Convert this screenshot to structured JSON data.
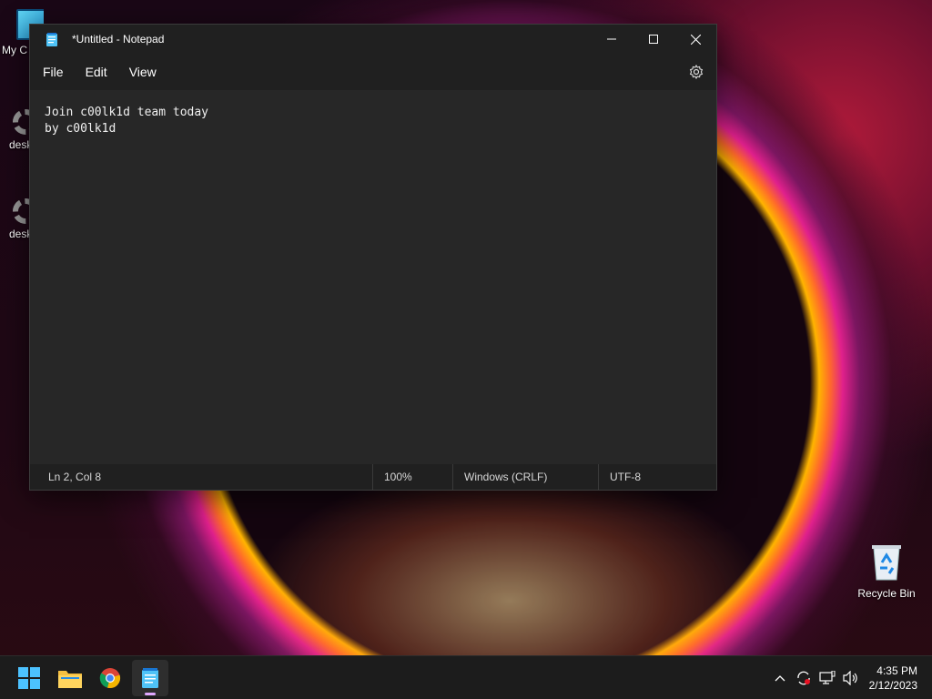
{
  "desktop": {
    "icons": [
      {
        "label": "My C",
        "name": "my-computer"
      },
      {
        "label": "desk",
        "name": "desktop-settings-1"
      },
      {
        "label": "desk",
        "name": "desktop-settings-2"
      },
      {
        "label": "Recycle Bin",
        "name": "recycle-bin"
      }
    ]
  },
  "window": {
    "title": "*Untitled - Notepad",
    "controls": [
      "minimize-icon",
      "maximize-icon",
      "close-icon"
    ]
  },
  "menu": {
    "file": "File",
    "edit": "Edit",
    "view": "View",
    "settings_icon": "gear-icon"
  },
  "editor": {
    "content": "Join c00lk1d team today\nby c00lk1d"
  },
  "status": {
    "position": "Ln 2, Col 8",
    "zoom": "100%",
    "line_ending": "Windows (CRLF)",
    "encoding": "UTF-8"
  },
  "taskbar": {
    "apps": [
      "start-icon",
      "file-explorer-icon",
      "chrome-icon",
      "notepad-icon"
    ],
    "clock_time": "4:35 PM",
    "clock_date": "2/12/2023"
  }
}
